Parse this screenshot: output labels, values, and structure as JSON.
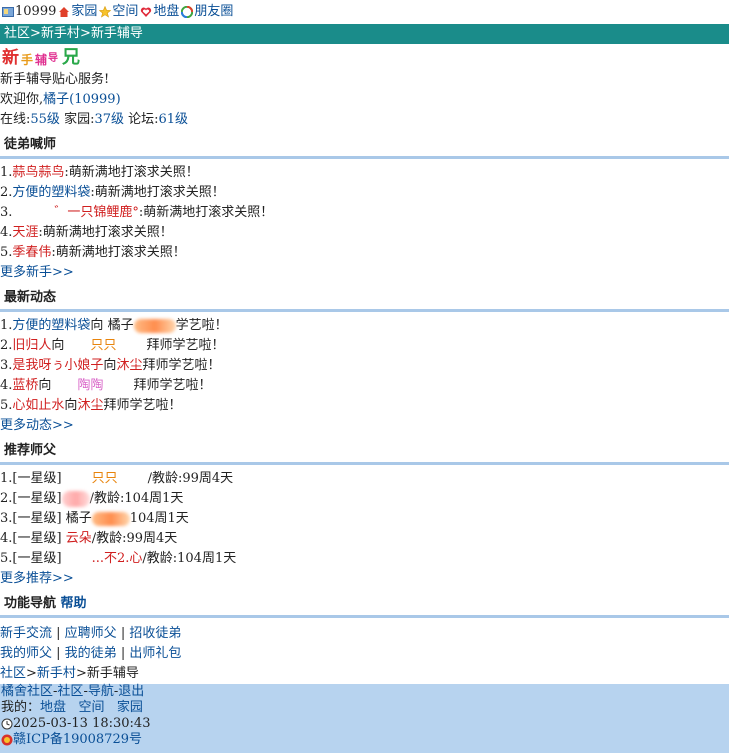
{
  "topbar": {
    "user_id": "10999",
    "links": [
      "家园",
      "空间",
      "地盘",
      "朋友圈"
    ]
  },
  "breadcrumb": [
    "社区",
    "新手村",
    "新手辅导"
  ],
  "logo_text": "新手辅导",
  "intro": {
    "service": "新手辅导贴心服务!",
    "welcome_prefix": "欢迎你,",
    "username": "橘子(10999)",
    "levels_online_label": "在线:",
    "levels_online": "55级",
    "levels_home_label": " 家园:",
    "levels_home": "37级",
    "levels_forum_label": " 论坛:",
    "levels_forum": "61级"
  },
  "apprentice_calls": {
    "title": "徒弟喊师",
    "items": [
      {
        "num": "1.",
        "name": "蒜鸟蒜鸟",
        "msg": ":萌新满地打滚求关照！"
      },
      {
        "num": "2.",
        "name": "方便的塑料袋",
        "msg": ":萌新满地打滚求关照！"
      },
      {
        "num": "3.",
        "name": "゛一只锦鲤鹿°",
        "msg": ":萌新满地打滚求关照！"
      },
      {
        "num": "4.",
        "name": "天涯",
        "msg": ":萌新满地打滚求关照！"
      },
      {
        "num": "5.",
        "name": "季春伟",
        "msg": ":萌新满地打滚求关照！"
      }
    ],
    "more": "更多新手>>"
  },
  "latest": {
    "title": "最新动态",
    "items": [
      {
        "num": "1.",
        "a": "方便的塑料袋",
        "to": "向",
        "b": "橘子",
        "tail": "学艺啦！"
      },
      {
        "num": "2.",
        "a": "旧归人",
        "to": "向",
        "b": "只只",
        "tail": "拜师学艺啦！"
      },
      {
        "num": "3.",
        "a": "是我呀ぅ小娘子",
        "to": "向",
        "b": "沐尘",
        "tail": "拜师学艺啦！"
      },
      {
        "num": "4.",
        "a": "蓝桥",
        "to": "向",
        "b": "陶陶",
        "tail": "拜师学艺啦！"
      },
      {
        "num": "5.",
        "a": "心如止水",
        "to": "向",
        "b": "沐尘",
        "tail": "拜师学艺啦！"
      }
    ],
    "more": "更多动态>>"
  },
  "masters": {
    "title": "推荐师父",
    "items": [
      {
        "num": "1.",
        "rank": "[一星级]",
        "name": "只只",
        "age": "/教龄:99周4天"
      },
      {
        "num": "2.",
        "rank": "[一星级]",
        "name": "",
        "age": "/教龄:104周1天"
      },
      {
        "num": "3.",
        "rank": "[一星级]",
        "name": "橘子",
        "age": "104周1天"
      },
      {
        "num": "4.",
        "rank": "[一星级]",
        "name": "云朵",
        "age": "/教龄:99周4天"
      },
      {
        "num": "5.",
        "rank": "[一星级]",
        "name": "...不2.心",
        "age": "/教龄:104周1天"
      }
    ],
    "more": "更多推荐>>"
  },
  "functions": {
    "title": "功能导航",
    "help": "帮助",
    "row1": [
      "新手交流",
      "应聘师父",
      "招收徒弟"
    ],
    "row2": [
      "我的师父",
      "我的徒弟",
      "出师礼包"
    ],
    "sep": " | "
  },
  "bottom_breadcrumb": [
    "社区",
    "新手村",
    "新手辅导"
  ],
  "footer": {
    "nav": [
      "橘舍社区",
      "社区",
      "导航",
      "退出"
    ],
    "my_label": "我的：",
    "my_links": [
      "地盘",
      "空间",
      "家园"
    ],
    "datetime": "2025-03-13 18:30:43",
    "icp": "赣ICP备19008729号"
  },
  "colors": {
    "teal_bar": "#1a8c8a",
    "section_rule": "#a9c8e8",
    "footer_bg": "#b7d3ef",
    "link": "#0a4f96",
    "name_red": "#d02020"
  }
}
